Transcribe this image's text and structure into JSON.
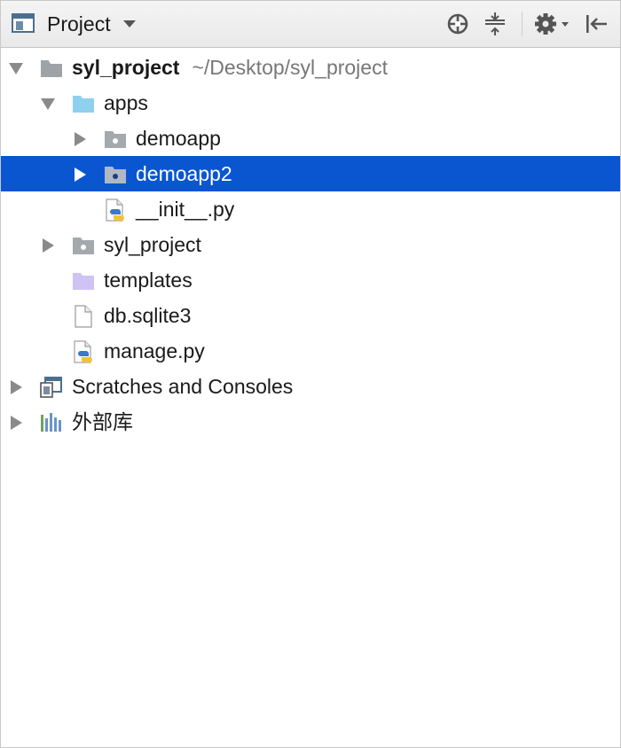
{
  "toolbar": {
    "view_title": "Project",
    "icons": [
      "project-view-icon",
      "dropdown-caret-icon",
      "locate-icon",
      "collapse-all-icon",
      "gear-icon",
      "hide-panel-icon"
    ]
  },
  "tree": {
    "root": {
      "name": "syl_project",
      "path": "~/Desktop/syl_project"
    },
    "apps": {
      "name": "apps"
    },
    "demoapp": {
      "name": "demoapp"
    },
    "demoapp2": {
      "name": "demoapp2",
      "selected": true
    },
    "init_py": {
      "name": "__init__.py"
    },
    "syl_project_pkg": {
      "name": "syl_project"
    },
    "templates": {
      "name": "templates"
    },
    "db": {
      "name": "db.sqlite3"
    },
    "manage": {
      "name": "manage.py"
    },
    "scratches": {
      "name": "Scratches and Consoles"
    },
    "external_libs": {
      "name": "外部库"
    }
  },
  "colors": {
    "selection": "#0a56d1",
    "folder_apps": "#8fd0ef",
    "folder_templates": "#cfc2f5",
    "folder_gray": "#a4a9ae",
    "path_text": "#777777"
  }
}
